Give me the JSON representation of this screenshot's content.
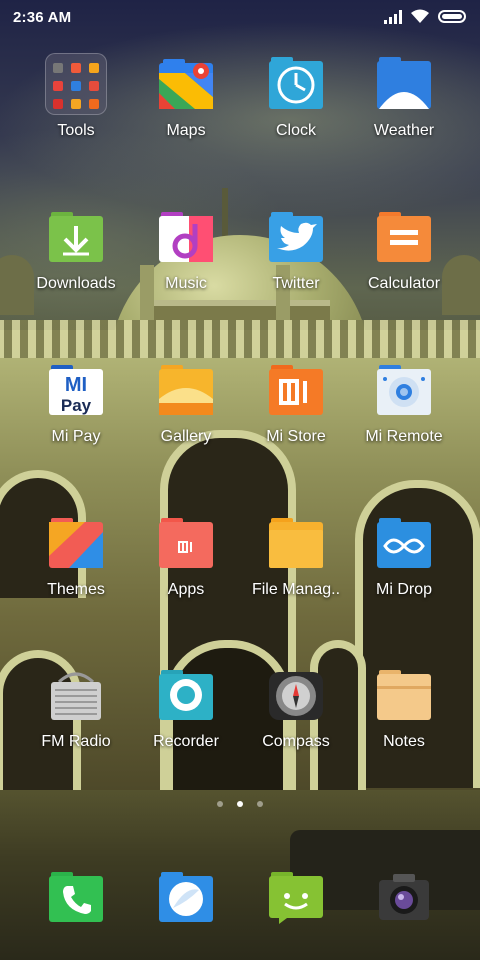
{
  "status_bar": {
    "time": "2:36 AM",
    "signal_icon": "signal-icon",
    "wifi_icon": "wifi-icon",
    "battery_icon": "battery-icon"
  },
  "home_grid": {
    "rows": [
      [
        {
          "label": "Tools",
          "icon": "tools-folder-icon"
        },
        {
          "label": "Maps",
          "icon": "maps-icon",
          "color": "#2f80ed"
        },
        {
          "label": "Clock",
          "icon": "clock-icon",
          "color": "#2fa6d8"
        },
        {
          "label": "Weather",
          "icon": "weather-icon",
          "color": "#2f7fe0"
        }
      ],
      [
        {
          "label": "Downloads",
          "icon": "downloads-icon",
          "color": "#6cb33f"
        },
        {
          "label": "Music",
          "icon": "music-icon",
          "color": "#b23fc2"
        },
        {
          "label": "Twitter",
          "icon": "twitter-icon",
          "color": "#38a0e6"
        },
        {
          "label": "Calculator",
          "icon": "calculator-icon",
          "color": "#f47a2c"
        }
      ],
      [
        {
          "label": "Mi Pay",
          "icon": "mi-pay-icon",
          "color": "#1f5fc4",
          "text": "MI Pay"
        },
        {
          "label": "Gallery",
          "icon": "gallery-icon",
          "color": "#f5a623"
        },
        {
          "label": "Mi Store",
          "icon": "mi-store-icon",
          "color": "#f06a1d",
          "text": "mi"
        },
        {
          "label": "Mi Remote",
          "icon": "mi-remote-icon",
          "color": "#2f7fe0"
        }
      ],
      [
        {
          "label": "Themes",
          "icon": "themes-icon",
          "color": "#f25c54"
        },
        {
          "label": "Apps",
          "icon": "apps-icon",
          "color": "#f2574a",
          "text": "mi"
        },
        {
          "label": "File Manag..",
          "icon": "file-manager-icon",
          "color": "#f5a21c"
        },
        {
          "label": "Mi Drop",
          "icon": "mi-drop-icon",
          "color": "#2c8fe0"
        }
      ],
      [
        {
          "label": "FM Radio",
          "icon": "fm-radio-icon",
          "color": "#bdbdbd"
        },
        {
          "label": "Recorder",
          "icon": "recorder-icon",
          "color": "#27a3b8"
        },
        {
          "label": "Compass",
          "icon": "compass-icon",
          "color": "#333333"
        },
        {
          "label": "Notes",
          "icon": "notes-icon",
          "color": "#f4c98a"
        }
      ]
    ]
  },
  "page_indicator": {
    "pages": 3,
    "active": 2
  },
  "dock": [
    {
      "icon": "phone-icon",
      "color": "#2bb34a"
    },
    {
      "icon": "browser-icon",
      "color": "#2f8ee6"
    },
    {
      "icon": "messaging-icon",
      "color": "#77b52b"
    },
    {
      "icon": "camera-icon",
      "color": "#6a4b9a"
    }
  ]
}
